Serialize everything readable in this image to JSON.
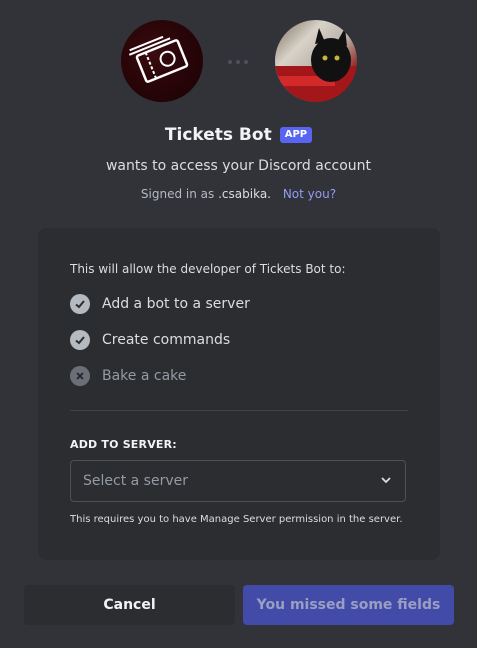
{
  "app": {
    "name": "Tickets Bot",
    "tag": "APP",
    "subtitle": "wants to access your Discord account"
  },
  "signed_in": {
    "prefix": "Signed in as",
    "username": ".csabika.",
    "not_you": "Not you?"
  },
  "panel": {
    "heading": "This will allow the developer of Tickets Bot to:",
    "permissions": [
      {
        "label": "Add a bot to a server",
        "granted": true
      },
      {
        "label": "Create commands",
        "granted": true
      },
      {
        "label": "Bake a cake",
        "granted": false
      }
    ],
    "server_section_label": "ADD TO SERVER:",
    "select": {
      "placeholder": "Select a server"
    },
    "hint": "This requires you to have Manage Server permission in the server."
  },
  "footer": {
    "cancel_label": "Cancel",
    "submit_label": "You missed some fields"
  },
  "colors": {
    "background": "#313338",
    "panel": "#2b2d31",
    "accent": "#5865f2",
    "link": "#949cf7"
  },
  "icons": {
    "granted": "check-circle-icon",
    "denied": "x-circle-icon",
    "dropdown": "chevron-down-icon"
  }
}
